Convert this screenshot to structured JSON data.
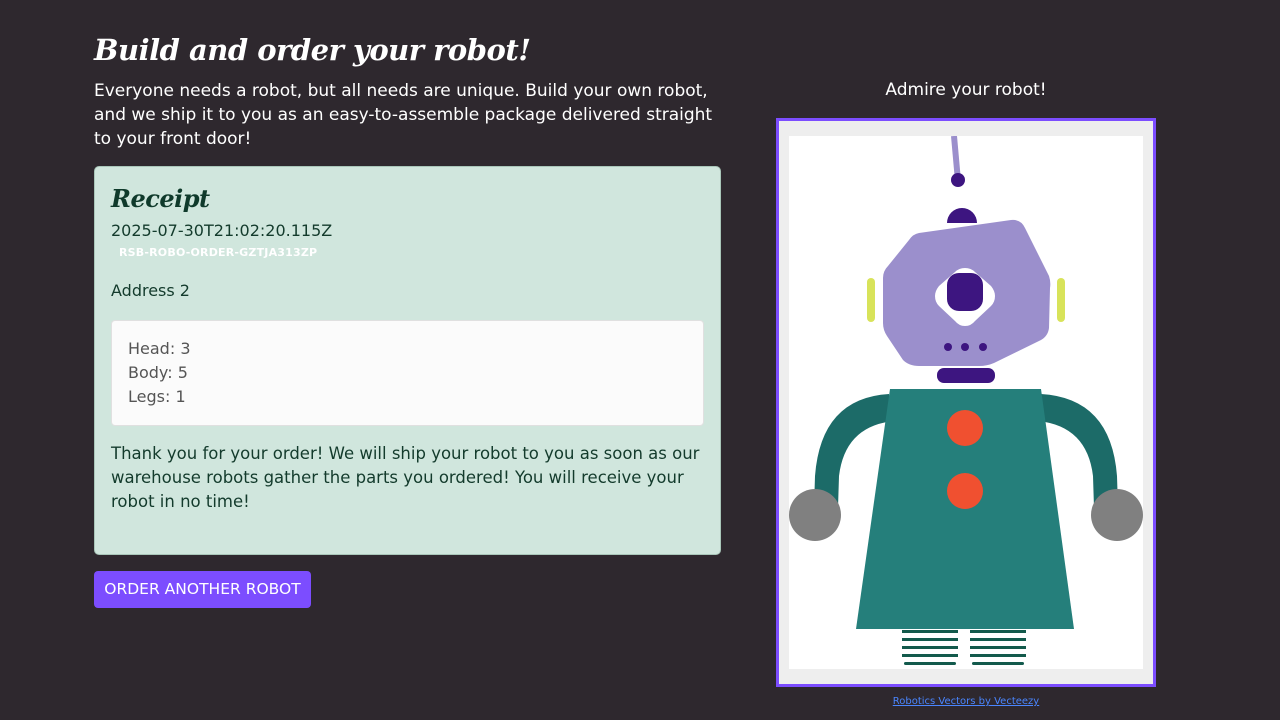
{
  "header": {
    "title": "Build and order your robot!",
    "intro": "Everyone needs a robot, but all needs are unique. Build your own robot, and we ship it to you as an easy-to-assemble package delivered straight to your front door!"
  },
  "receipt": {
    "title": "Receipt",
    "timestamp": "2025-07-30T21:02:20.115Z",
    "order_id": "RSB-ROBO-ORDER-GZTJA313ZP",
    "address": "Address 2",
    "parts": [
      {
        "label": "Head: 3"
      },
      {
        "label": "Body: 5"
      },
      {
        "label": "Legs: 1"
      }
    ],
    "message": "Thank you for your order! We will ship your robot to you as soon as our warehouse robots gather the parts you ordered! You will receive your robot in no time!"
  },
  "actions": {
    "order_another_label": "ORDER ANOTHER ROBOT"
  },
  "preview": {
    "caption": "Admire your robot!",
    "credit": "Robotics Vectors by Vecteezy"
  },
  "colors": {
    "background": "#2e282e",
    "accent": "#7c4dff",
    "receipt_bg": "#d0e6dd",
    "robot_head": "#9b8fcc",
    "robot_body": "#257f7b",
    "robot_arm": "#1c6b68",
    "robot_button": "#f05030"
  }
}
